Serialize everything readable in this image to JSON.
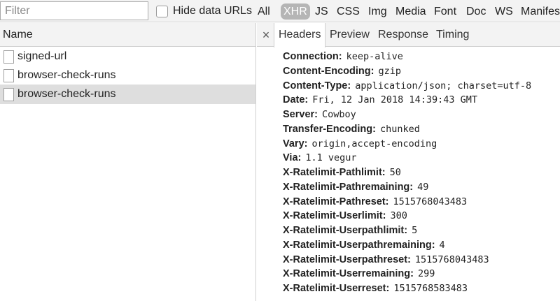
{
  "filterbar": {
    "filter_placeholder": "Filter",
    "hide_data_urls_label": "Hide data URLs",
    "hide_data_urls_checked": false,
    "types": [
      "All",
      "XHR",
      "JS",
      "CSS",
      "Img",
      "Media",
      "Font",
      "Doc",
      "WS",
      "Manifest"
    ],
    "active_type": "XHR"
  },
  "requests": {
    "column_header": "Name",
    "items": [
      {
        "name": "signed-url",
        "selected": false
      },
      {
        "name": "browser-check-runs",
        "selected": false
      },
      {
        "name": "browser-check-runs",
        "selected": true
      }
    ]
  },
  "details": {
    "close_label": "×",
    "tabs": [
      "Headers",
      "Preview",
      "Response",
      "Timing"
    ],
    "active_tab": "Headers",
    "headers": [
      {
        "key": "Connection:",
        "value": "keep-alive"
      },
      {
        "key": "Content-Encoding:",
        "value": "gzip"
      },
      {
        "key": "Content-Type:",
        "value": "application/json; charset=utf-8"
      },
      {
        "key": "Date:",
        "value": "Fri, 12 Jan 2018 14:39:43 GMT"
      },
      {
        "key": "Server:",
        "value": "Cowboy"
      },
      {
        "key": "Transfer-Encoding:",
        "value": "chunked"
      },
      {
        "key": "Vary:",
        "value": "origin,accept-encoding"
      },
      {
        "key": "Via:",
        "value": "1.1 vegur"
      },
      {
        "key": "X-Ratelimit-Pathlimit:",
        "value": "50"
      },
      {
        "key": "X-Ratelimit-Pathremaining:",
        "value": "49"
      },
      {
        "key": "X-Ratelimit-Pathreset:",
        "value": "1515768043483"
      },
      {
        "key": "X-Ratelimit-Userlimit:",
        "value": "300"
      },
      {
        "key": "X-Ratelimit-Userpathlimit:",
        "value": "5"
      },
      {
        "key": "X-Ratelimit-Userpathremaining:",
        "value": "4"
      },
      {
        "key": "X-Ratelimit-Userpathreset:",
        "value": "1515768043483"
      },
      {
        "key": "X-Ratelimit-Userremaining:",
        "value": "299"
      },
      {
        "key": "X-Ratelimit-Userreset:",
        "value": "1515768583483"
      }
    ]
  }
}
